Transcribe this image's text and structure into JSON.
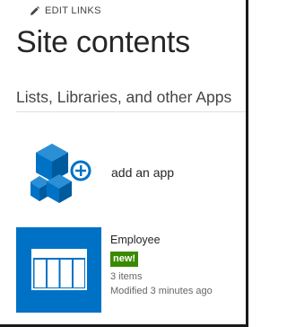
{
  "toolbar": {
    "edit_links_label": "EDIT LINKS",
    "edit_icon": "pencil-icon"
  },
  "page": {
    "title": "Site contents",
    "section_title": "Lists, Libraries, and other Apps"
  },
  "add_app": {
    "label": "add an app",
    "icon": "add-app-icon"
  },
  "apps": [
    {
      "name": "Employee",
      "badge": "new!",
      "item_count": "3 items",
      "modified": "Modified 3 minutes ago",
      "icon": "list-table-icon"
    }
  ],
  "colors": {
    "accent": "#0072c6",
    "new_badge": "#3a8a00",
    "title_text": "#262626",
    "meta_text": "#666666"
  }
}
